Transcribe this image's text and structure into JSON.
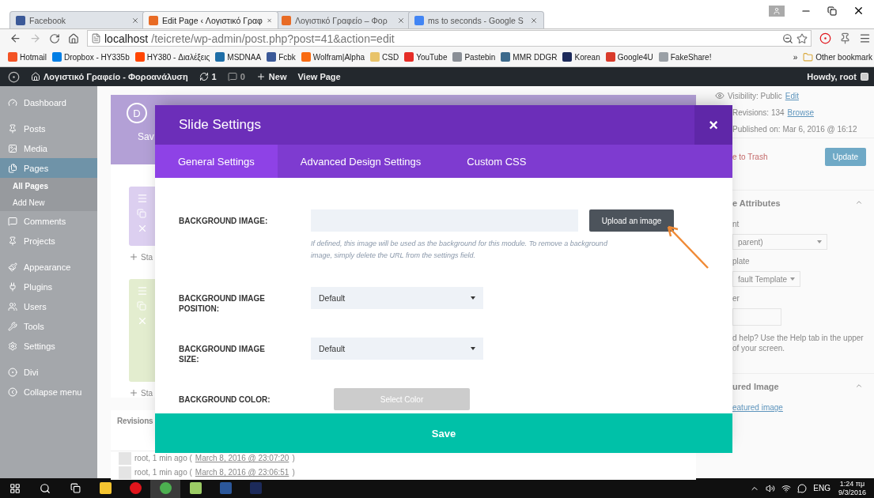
{
  "browser": {
    "tabs": [
      {
        "title": "Facebook",
        "selected": false
      },
      {
        "title": "Edit Page ‹ Λογιστικό Γραφ",
        "selected": true
      },
      {
        "title": "Λογιστικό Γραφείο – Φορ",
        "selected": false
      },
      {
        "title": "ms to seconds - Google S",
        "selected": false
      }
    ],
    "address": {
      "host": "localhost",
      "path": "/teicrete/wp-admin/post.php?post=41&action=edit"
    },
    "bookmarks": [
      {
        "label": "Hotmail",
        "color": "#f35325"
      },
      {
        "label": "Dropbox - HY335b",
        "color": "#007ee5"
      },
      {
        "label": "HY380 - Διαλέξεις",
        "color": "#ff4500"
      },
      {
        "label": "MSDNAA",
        "color": "#1e6ea7"
      },
      {
        "label": "Fcbk",
        "color": "#3b5998"
      },
      {
        "label": "Wolfram|Alpha",
        "color": "#f96b12"
      },
      {
        "label": "CSD",
        "color": "#e8c36a"
      },
      {
        "label": "YouTube",
        "color": "#e52d27"
      },
      {
        "label": "Pastebin",
        "color": "#8a8f96"
      },
      {
        "label": "MMR DDGR",
        "color": "#3d6a8c"
      },
      {
        "label": "Korean",
        "color": "#1c2a5a"
      },
      {
        "label": "Google4U",
        "color": "#d93b2b"
      },
      {
        "label": "FakeShare!",
        "color": "#9aa0a6"
      }
    ],
    "overflow": "»",
    "other_bookmarks": "Other bookmark"
  },
  "admin_bar": {
    "site": "Λογιστικό Γραφείο - Φοροανάλυση",
    "updates": "1",
    "comments": "0",
    "new": "New",
    "view": "View Page",
    "howdy": "Howdy, root"
  },
  "sidebar": {
    "items": [
      {
        "label": "Dashboard",
        "selected": false
      },
      {
        "label": "Posts",
        "selected": false
      },
      {
        "label": "Media",
        "selected": false
      },
      {
        "label": "Pages",
        "selected": true,
        "children": [
          {
            "label": "All Pages",
            "selected": true
          },
          {
            "label": "Add New",
            "selected": false
          }
        ]
      },
      {
        "label": "Comments",
        "selected": false
      },
      {
        "label": "Projects",
        "selected": false
      },
      {
        "label": "Appearance",
        "selected": false
      },
      {
        "label": "Plugins",
        "selected": false
      },
      {
        "label": "Users",
        "selected": false
      },
      {
        "label": "Tools",
        "selected": false
      },
      {
        "label": "Settings",
        "selected": false
      },
      {
        "label": "Divi",
        "selected": false
      },
      {
        "label": "Collapse menu",
        "selected": false
      }
    ]
  },
  "builder": {
    "logo": "D",
    "save_fragment": "Sav",
    "sections": [
      {
        "color": "#dccff0",
        "label": "Sta"
      },
      {
        "color": "#e3edcf",
        "label": "Sta"
      }
    ]
  },
  "revisions": {
    "title": "Revisions",
    "rows": [
      {
        "text": "root, 1 min ago (",
        "link": "March 8, 2016 @ 23:07:20",
        "close": ")"
      },
      {
        "text": "root, 1 min ago (",
        "link": "March 8, 2016 @ 23:06:51",
        "close": ")"
      }
    ]
  },
  "publish": {
    "visibility": "Visibility: Public",
    "visibility_link": "Edit",
    "revisions": "Revisions: 134",
    "revisions_link": "Browse",
    "published": "Published on: Mar 6, 2016 @ 16:12",
    "trash": "e to Trash",
    "update": "Update"
  },
  "attributes": {
    "title": "e Attributes",
    "parent_label": "nt",
    "parent_value": "parent)",
    "template_label": "plate",
    "template_value": "fault Template",
    "order_label": "er",
    "help": "d help? Use the Help tab in the upper",
    "help2": "of your screen."
  },
  "featured": {
    "title": "ured Image",
    "link": "eatured image"
  },
  "modal": {
    "title": "Slide Settings",
    "close": "×",
    "tabs": [
      {
        "label": "General Settings",
        "selected": true
      },
      {
        "label": "Advanced Design Settings",
        "selected": false
      },
      {
        "label": "Custom CSS",
        "selected": false
      }
    ],
    "fields": [
      {
        "kind": "upload",
        "label": "BACKGROUND IMAGE:",
        "button": "Upload an image",
        "hint": "If defined, this image will be used as the background for this module. To remove a background image, simply delete the URL from the settings field."
      },
      {
        "kind": "select",
        "label": "BACKGROUND IMAGE POSITION:",
        "value": "Default"
      },
      {
        "kind": "select",
        "label": "BACKGROUND IMAGE SIZE:",
        "value": "Default"
      },
      {
        "kind": "color",
        "label": "BACKGROUND COLOR:",
        "button": "Select Color"
      }
    ],
    "save": "Save"
  },
  "taskbar": {
    "apps": [
      {
        "kind": "explorer",
        "selected": false
      },
      {
        "kind": "opera",
        "selected": false
      },
      {
        "kind": "chrome",
        "selected": true
      },
      {
        "kind": "app",
        "selected": false
      },
      {
        "kind": "word",
        "selected": false
      },
      {
        "kind": "league",
        "selected": false
      }
    ],
    "lang": "ENG",
    "time": "1:24 πμ",
    "date": "9/3/2016"
  }
}
